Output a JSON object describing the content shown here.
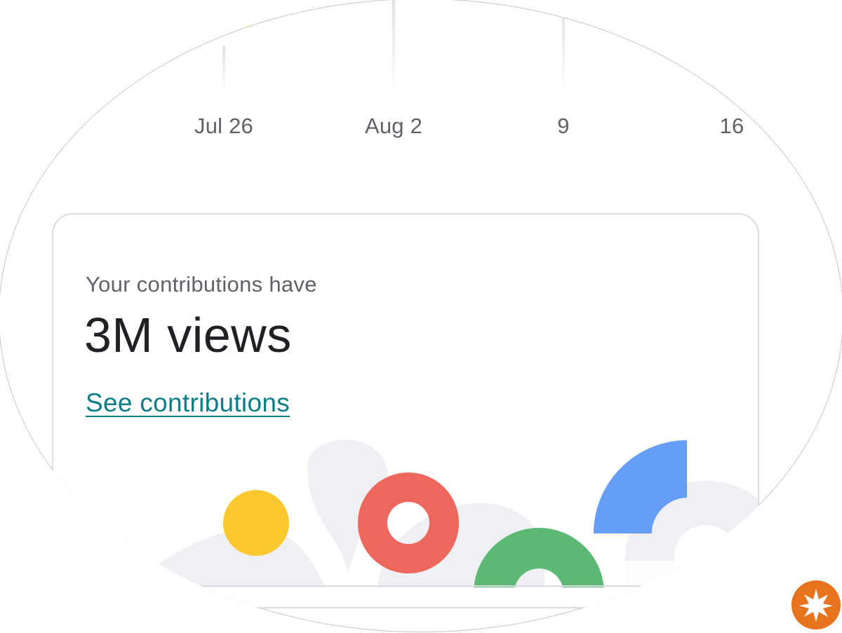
{
  "chart": {
    "tick_labels": [
      "Jul 26",
      "Aug 2",
      "9",
      "16"
    ],
    "line_color": "#fbbc04"
  },
  "card": {
    "subtitle": "Your contributions have",
    "headline": "3M views",
    "link_label": "See contributions",
    "link_color": "#0b7d87"
  },
  "illustration": {
    "colors": {
      "yellow": "#fbc92f",
      "red": "#ee675c",
      "green": "#5bb974",
      "blue": "#669df6",
      "gray": "#eef0f3"
    }
  },
  "badge": {
    "icon": "starburst-icon",
    "color": "#e8731f"
  }
}
